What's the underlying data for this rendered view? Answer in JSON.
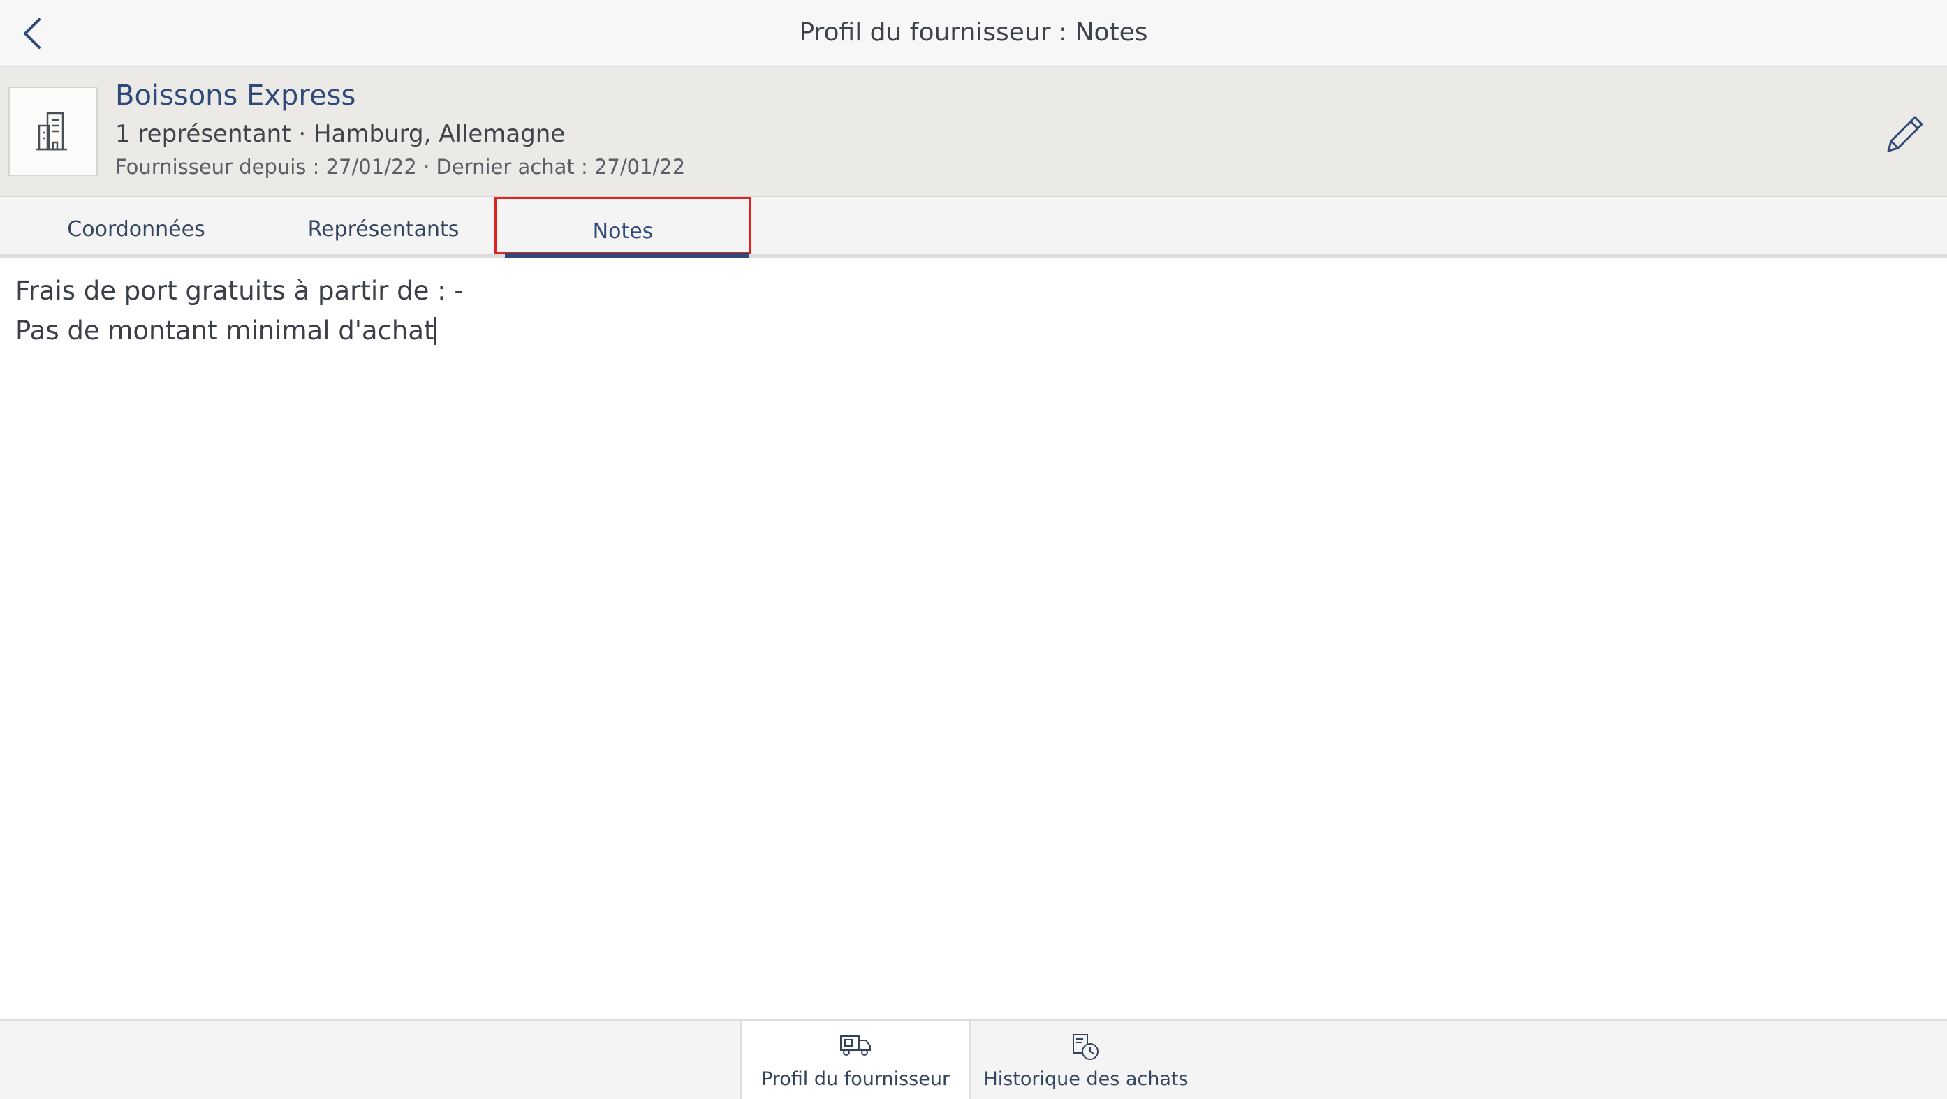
{
  "nav": {
    "title": "Profil du fournisseur : Notes",
    "back_icon": "chevron-left-icon"
  },
  "supplier": {
    "name": "Boissons Express",
    "summary": "1 représentant · Hamburg, Allemagne",
    "dates": "Fournisseur depuis : 27/01/22 · Dernier achat : 27/01/22",
    "avatar_icon": "building-icon",
    "edit_icon": "pencil-icon"
  },
  "tabs": [
    {
      "label": "Coordonnées",
      "active": false
    },
    {
      "label": "Représentants",
      "active": false
    },
    {
      "label": "Notes",
      "active": true
    }
  ],
  "notes": {
    "line1": "Frais de port gratuits à partir de : -",
    "line2": "Pas de montant minimal d'achat"
  },
  "bottom_tabs": [
    {
      "label": "Profil du fournisseur",
      "icon": "truck-icon",
      "active": true
    },
    {
      "label": "Historique des achats",
      "icon": "history-icon",
      "active": false
    }
  ],
  "colors": {
    "accent": "#2f4a7a",
    "highlight": "#e02424",
    "header_bg": "#ebeae6"
  }
}
